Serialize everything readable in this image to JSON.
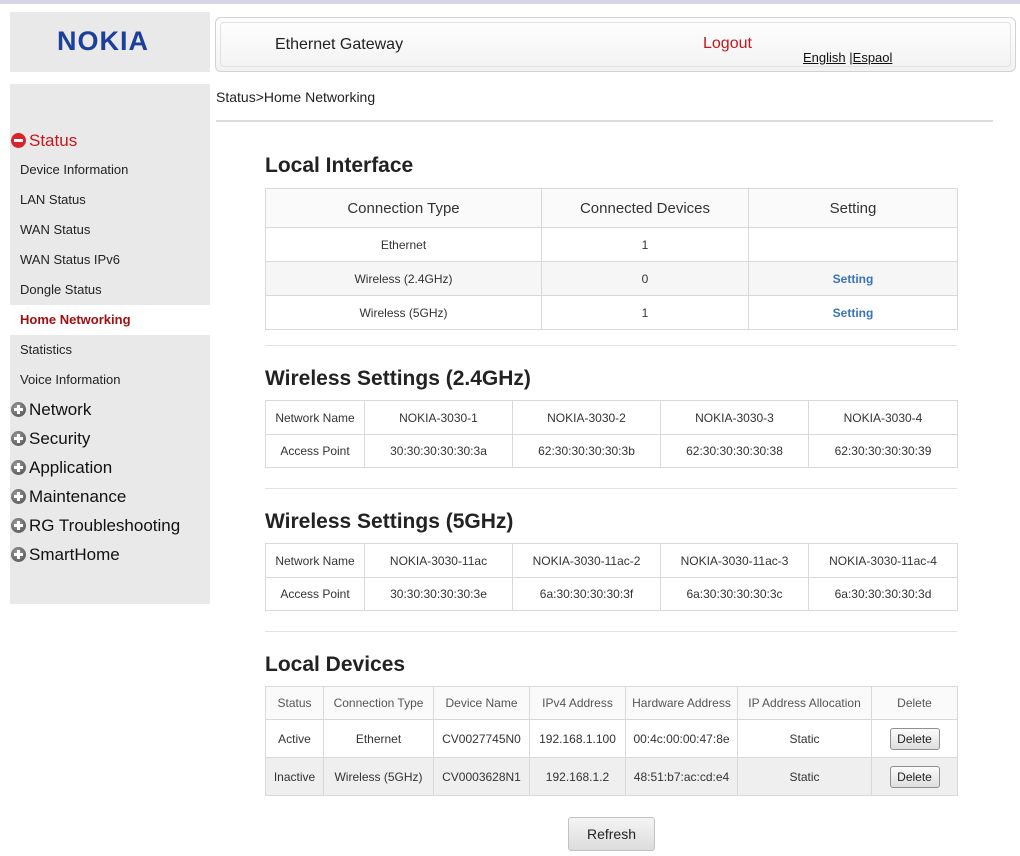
{
  "brand": {
    "logo": "NOKIA",
    "logo_color": "#1c3f9a"
  },
  "header": {
    "title": "Ethernet Gateway",
    "logout": "Logout",
    "lang_english": "English",
    "lang_sep": "|",
    "lang_espanol": "Espaol"
  },
  "breadcrumb": "Status>Home Networking",
  "sidebar": {
    "status": "Status",
    "status_items": [
      "Device Information",
      "LAN Status",
      "WAN Status",
      "WAN Status IPv6",
      "Dongle Status",
      "Home Networking",
      "Statistics",
      "Voice Information"
    ],
    "active_item": "Home Networking",
    "categories": [
      "Network",
      "Security",
      "Application",
      "Maintenance",
      "RG Troubleshooting",
      "SmartHome"
    ]
  },
  "local_interface": {
    "title": "Local Interface",
    "headers": [
      "Connection Type",
      "Connected Devices",
      "Setting"
    ],
    "rows": [
      {
        "type": "Ethernet",
        "devices": "1",
        "setting": ""
      },
      {
        "type": "Wireless (2.4GHz)",
        "devices": "0",
        "setting": "Setting"
      },
      {
        "type": "Wireless (5GHz)",
        "devices": "1",
        "setting": "Setting"
      }
    ]
  },
  "wireless_24": {
    "title": "Wireless Settings (2.4GHz)",
    "row_labels": [
      "Network Name",
      "Access Point"
    ],
    "names": [
      "NOKIA-3030-1",
      "NOKIA-3030-2",
      "NOKIA-3030-3",
      "NOKIA-3030-4"
    ],
    "aps": [
      "30:30:30:30:30:3a",
      "62:30:30:30:30:3b",
      "62:30:30:30:30:38",
      "62:30:30:30:30:39"
    ]
  },
  "wireless_5": {
    "title": "Wireless Settings (5GHz)",
    "row_labels": [
      "Network Name",
      "Access Point"
    ],
    "names": [
      "NOKIA-3030-11ac",
      "NOKIA-3030-11ac-2",
      "NOKIA-3030-11ac-3",
      "NOKIA-3030-11ac-4"
    ],
    "aps": [
      "30:30:30:30:30:3e",
      "6a:30:30:30:30:3f",
      "6a:30:30:30:30:3c",
      "6a:30:30:30:30:3d"
    ]
  },
  "local_devices": {
    "title": "Local Devices",
    "headers": [
      "Status",
      "Connection Type",
      "Device Name",
      "IPv4 Address",
      "Hardware Address",
      "IP Address Allocation",
      "Delete"
    ],
    "rows": [
      {
        "status": "Active",
        "conn": "Ethernet",
        "name": "CV0027745N0",
        "ipv4": "192.168.1.100",
        "hw": "00:4c:00:00:47:8e",
        "alloc": "Static",
        "delete": "Delete"
      },
      {
        "status": "Inactive",
        "conn": "Wireless (5GHz)",
        "name": "CV0003628N1",
        "ipv4": "192.168.1.2",
        "hw": "48:51:b7:ac:cd:e4",
        "alloc": "Static",
        "delete": "Delete"
      }
    ]
  },
  "refresh_label": "Refresh"
}
